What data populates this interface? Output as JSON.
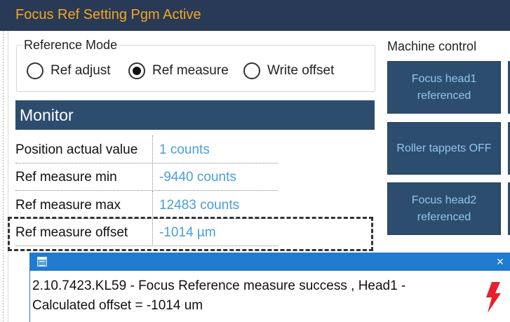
{
  "window": {
    "title": "Focus Ref Setting Pgm Active"
  },
  "reference_mode": {
    "legend": "Reference Mode",
    "options": [
      {
        "label": "Ref adjust",
        "selected": false
      },
      {
        "label": "Ref measure",
        "selected": true
      },
      {
        "label": "Write offset",
        "selected": false
      }
    ]
  },
  "monitor": {
    "title": "Monitor",
    "rows": [
      {
        "label": "Position actual value",
        "value": "1 counts"
      },
      {
        "label": "Ref measure min",
        "value": "-9440 counts"
      },
      {
        "label": "Ref measure max",
        "value": "12483 counts"
      },
      {
        "label": "Ref measure offset",
        "value": "-1014 µm"
      }
    ]
  },
  "machine_control": {
    "title": "Machine control",
    "buttons": [
      {
        "label": "Focus head1 referenced"
      },
      {
        "label": "Roller tappets OFF"
      },
      {
        "label": "Focus head2 referenced"
      }
    ]
  },
  "notification": {
    "close_glyph": "×",
    "message": "2.10.7423.KL59 - Focus Reference measure success , Head1 - Calculated offset = -1014 um",
    "icon": "lightning-bolt-icon"
  },
  "colors": {
    "title_accent": "#f5a623",
    "panel_dark": "#2d4d6e",
    "value_blue": "#4a9ed8",
    "toast_blue": "#1f7ad0",
    "bolt_red": "#e8202a"
  }
}
